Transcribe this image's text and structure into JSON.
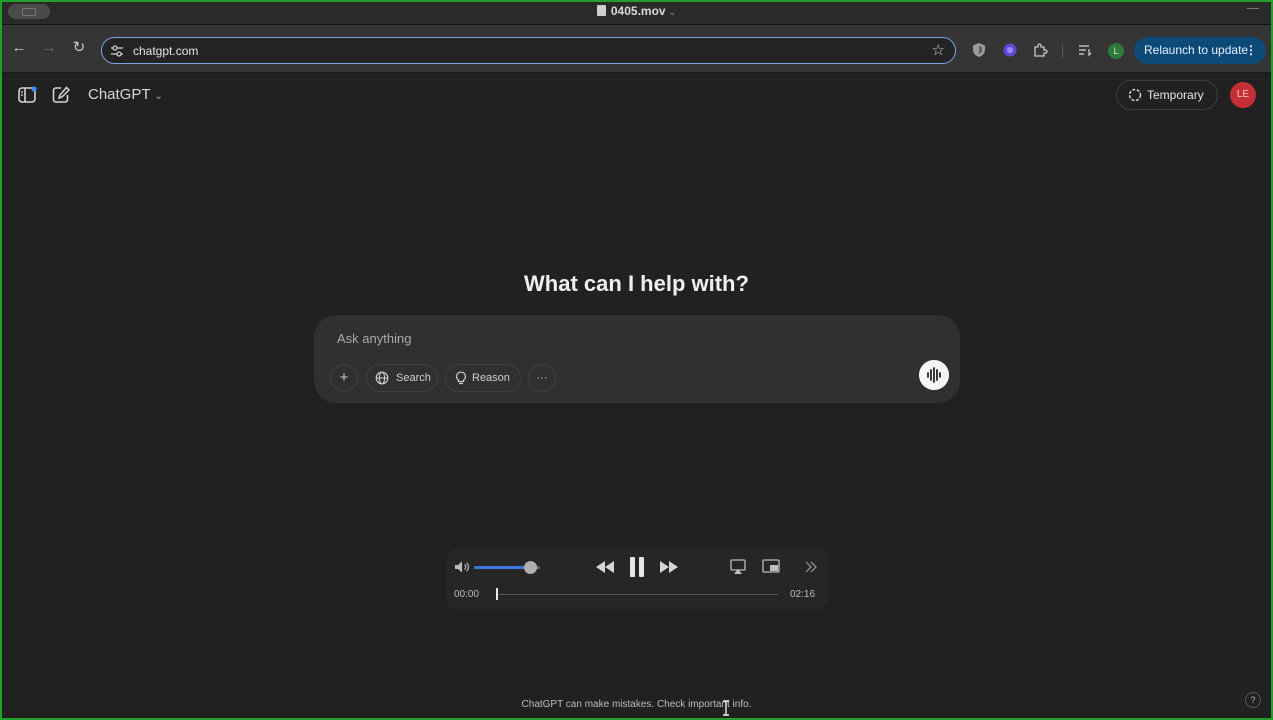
{
  "window": {
    "title": "0405.mov"
  },
  "browser": {
    "url": "chatgpt.com",
    "profile_initial": "L",
    "relaunch_label": "Relaunch to update"
  },
  "header": {
    "model_name": "ChatGPT",
    "temporary_label": "Temporary",
    "user_initials": "LE"
  },
  "main": {
    "headline": "What can I help with?",
    "composer": {
      "placeholder": "Ask anything",
      "plus_label": "+",
      "search_label": "Search",
      "reason_label": "Reason",
      "more_label": "···"
    }
  },
  "player": {
    "current_time": "00:00",
    "duration": "02:16",
    "volume_fraction": 0.85,
    "progress_fraction": 0.0
  },
  "footer": {
    "disclaimer": "ChatGPT can make mistakes. Check important info.",
    "help_label": "?"
  },
  "colors": {
    "background": "#212121",
    "accent_blue": "#3a77e0",
    "relaunch_bg": "#0e4a78",
    "avatar_red": "#c52f36",
    "profile_green": "#2f7b3c"
  },
  "icons": [
    "back-icon",
    "forward-icon",
    "reload-icon",
    "site-settings-icon",
    "bookmark-star-icon",
    "shield-extension-icon",
    "purple-extension-icon",
    "puzzle-extensions-icon",
    "reading-list-icon",
    "sidebar-toggle-icon",
    "new-chat-icon",
    "temporary-chat-icon",
    "globe-icon",
    "lightbulb-icon",
    "voice-mode-icon",
    "volume-icon",
    "rewind-icon",
    "pause-icon",
    "fast-forward-icon",
    "airplay-icon",
    "picture-in-picture-icon",
    "more-controls-icon"
  ]
}
